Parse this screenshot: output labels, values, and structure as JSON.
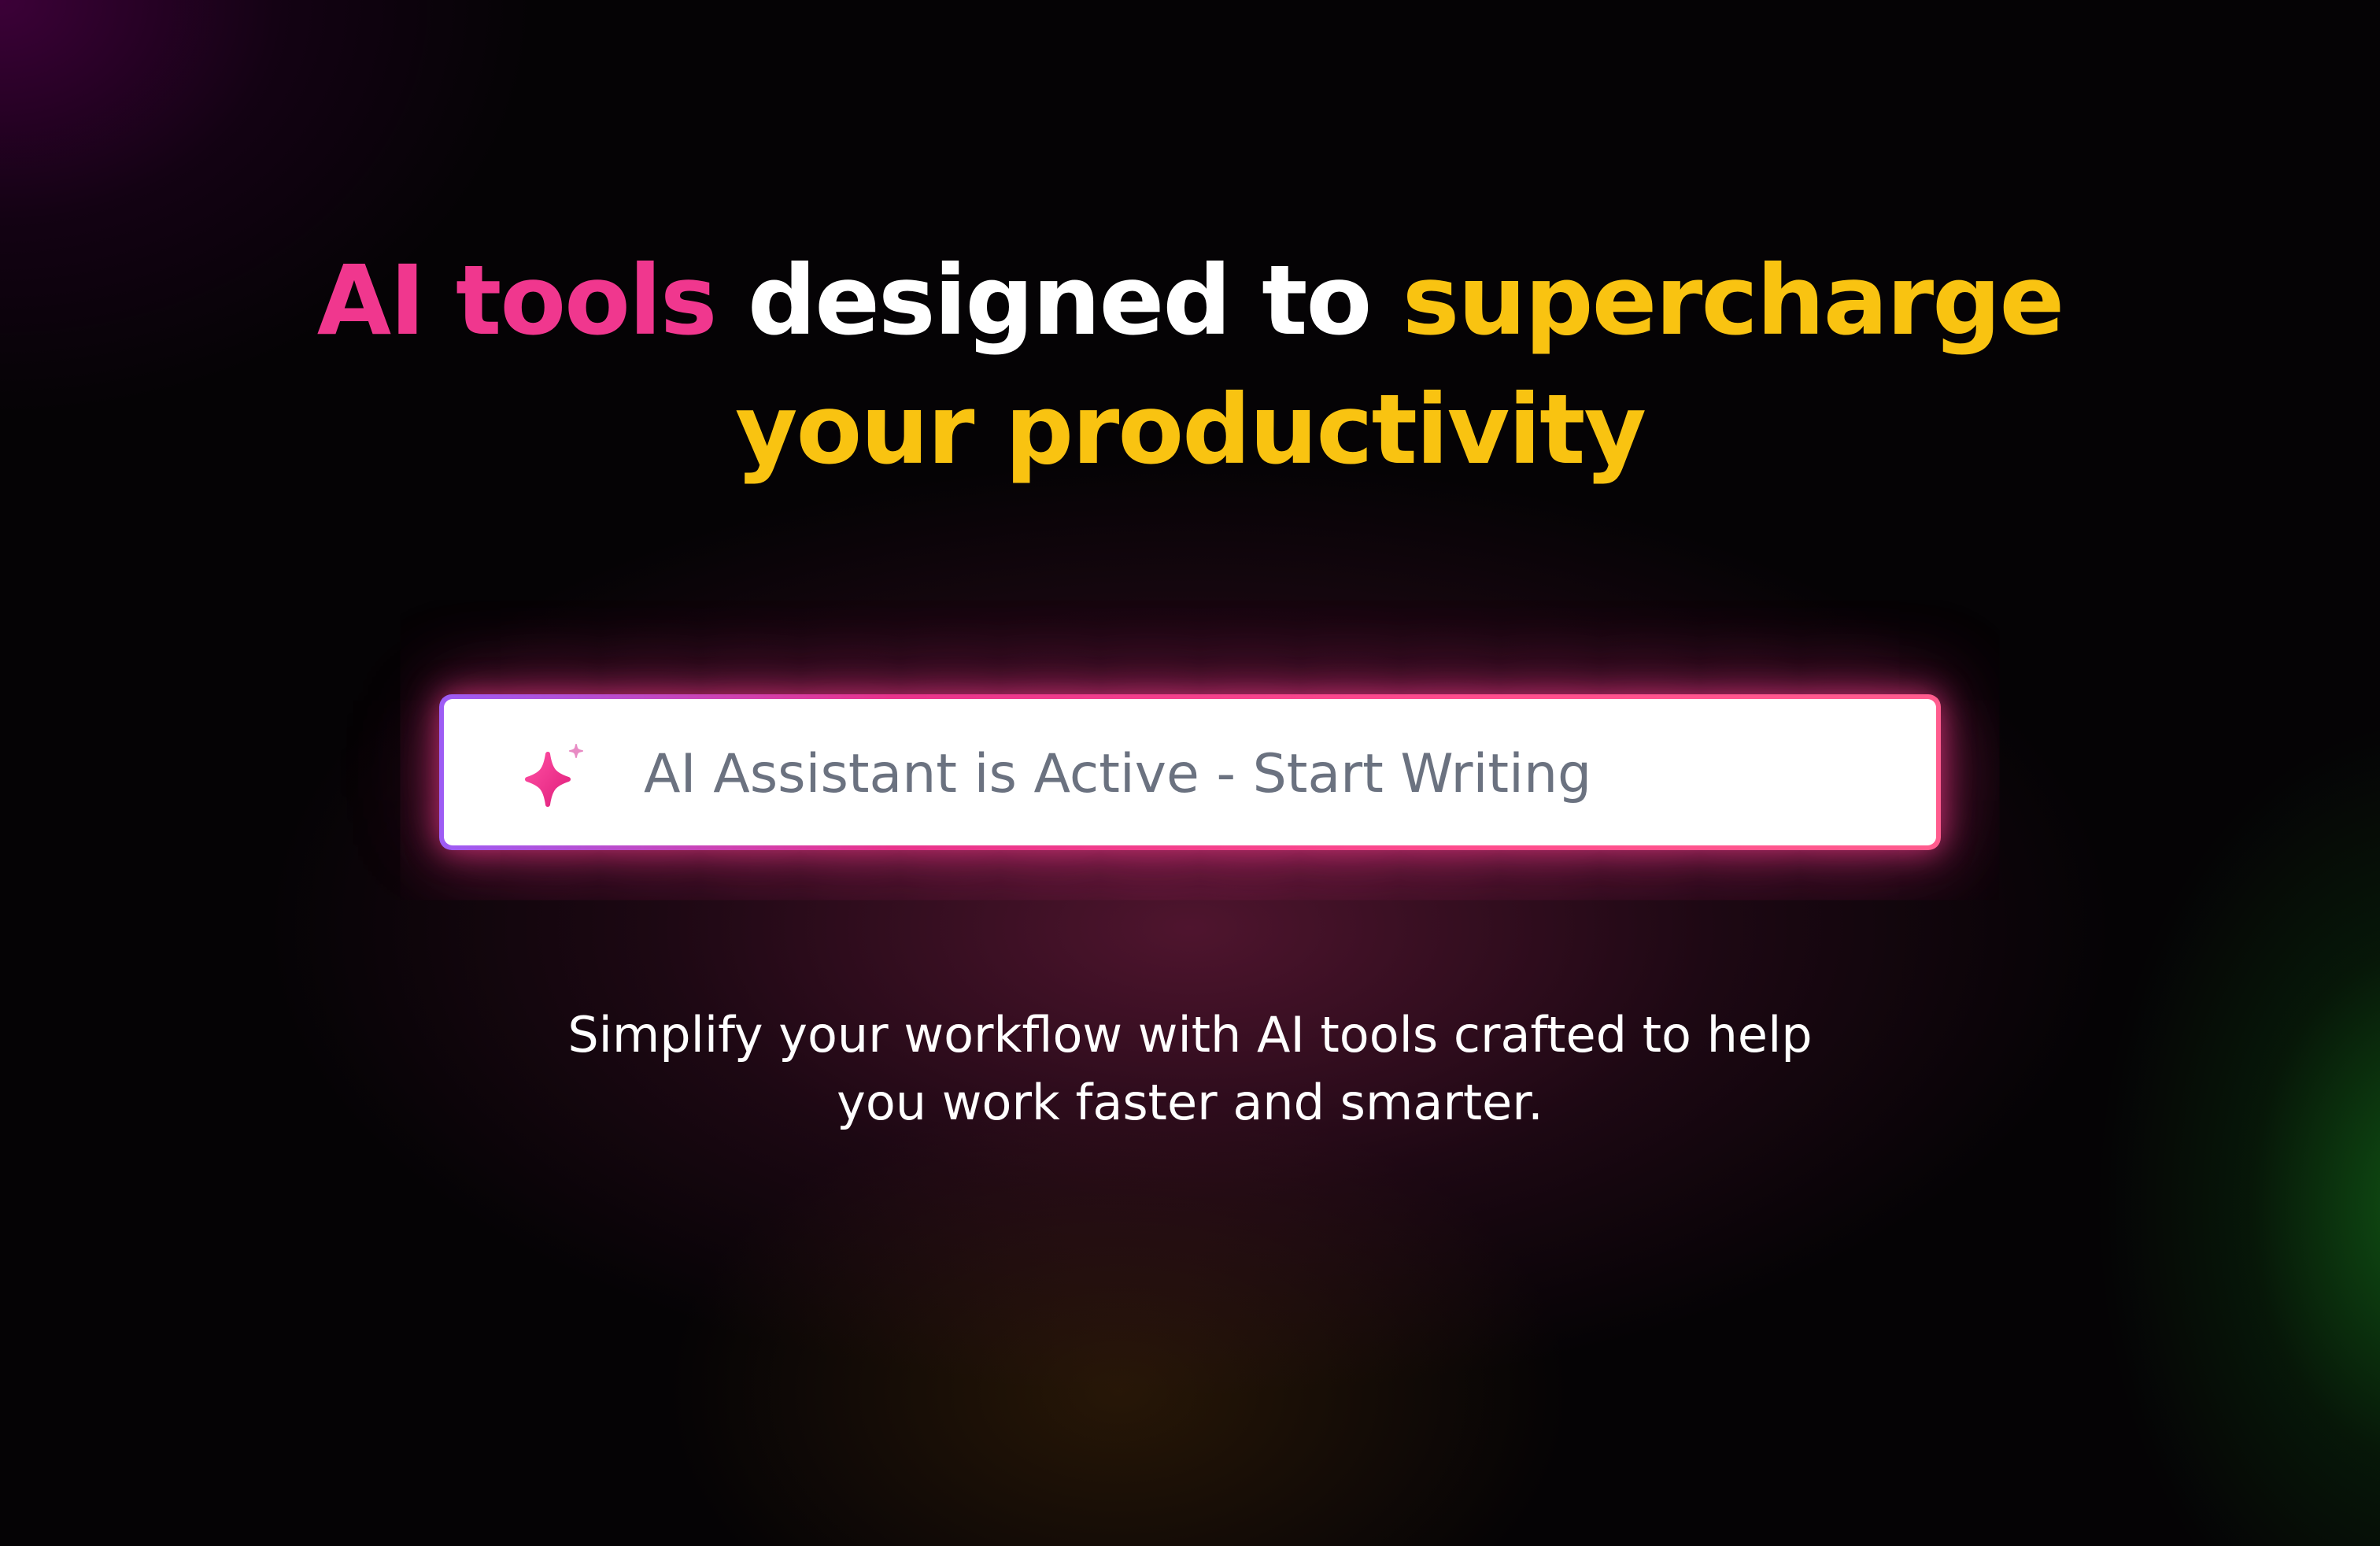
{
  "hero": {
    "headline": {
      "line1": {
        "part1": "AI tools",
        "part2": " designed to ",
        "part3": "supercharge"
      },
      "line2": "your productivity"
    },
    "colors": {
      "pink": "#f0378e",
      "white": "#ffffff",
      "yellow": "#f9c311"
    }
  },
  "assistant": {
    "icon": "sparkle-icon",
    "placeholder": "AI Assistant is Active - Start Writing",
    "border_gradient": [
      "#9d5cf5",
      "#e8338c",
      "#ff5c8e"
    ]
  },
  "subtext": {
    "line1": "Simplify your workflow with AI tools crafted to help",
    "line2": "you work faster and smarter."
  }
}
